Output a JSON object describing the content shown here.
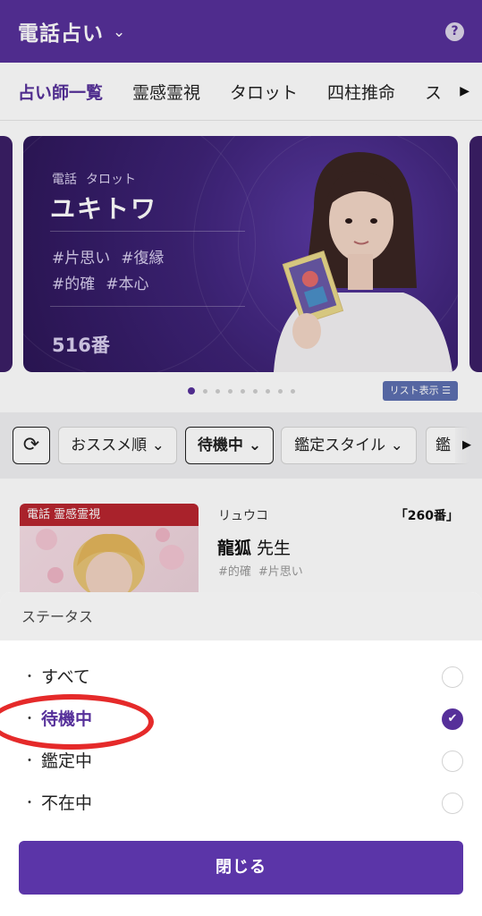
{
  "header": {
    "title": "電話占い",
    "chevron_icon": "chevron-down-icon",
    "help_icon": "question-circle-icon",
    "help_glyph": "?"
  },
  "tabs": [
    {
      "label": "占い師一覧",
      "active": true
    },
    {
      "label": "霊感霊視"
    },
    {
      "label": "タロット"
    },
    {
      "label": "四柱推命"
    },
    {
      "label": "ス"
    }
  ],
  "banner": {
    "category_1": "電話",
    "category_2": "タロット",
    "name": "ユキトワ",
    "tags_row1": [
      "#片思い",
      "#復縁"
    ],
    "tags_row2": [
      "#的確",
      "#本心"
    ],
    "number": "516番",
    "slide_count": 9,
    "active_slide": 1,
    "list_button": "リスト表示 ☰"
  },
  "filters": {
    "refresh_icon": "refresh-icon",
    "chips": [
      "おススメ順 ⌄",
      "待機中 ⌄",
      "鑑定スタイル ⌄",
      "鑑"
    ],
    "selected": "待機中"
  },
  "card": {
    "badge": "電話 霊感霊視",
    "kana": "リュウコ",
    "number": "「260番」",
    "name": "龍狐",
    "honorific": " 先生",
    "tags": [
      "#的確",
      "#片思い"
    ]
  },
  "sheet": {
    "title": "ステータス",
    "options": [
      {
        "label": "すべて",
        "selected": false
      },
      {
        "label": "待機中",
        "selected": true
      },
      {
        "label": "鑑定中",
        "selected": false
      },
      {
        "label": "不在中",
        "selected": false
      }
    ],
    "bullet": "・",
    "check_glyph": "✔",
    "close_label": "閉じる"
  },
  "colors": {
    "brand": "#56309a",
    "badge_red": "#b8252f",
    "annotation_red": "#e52a2a"
  }
}
